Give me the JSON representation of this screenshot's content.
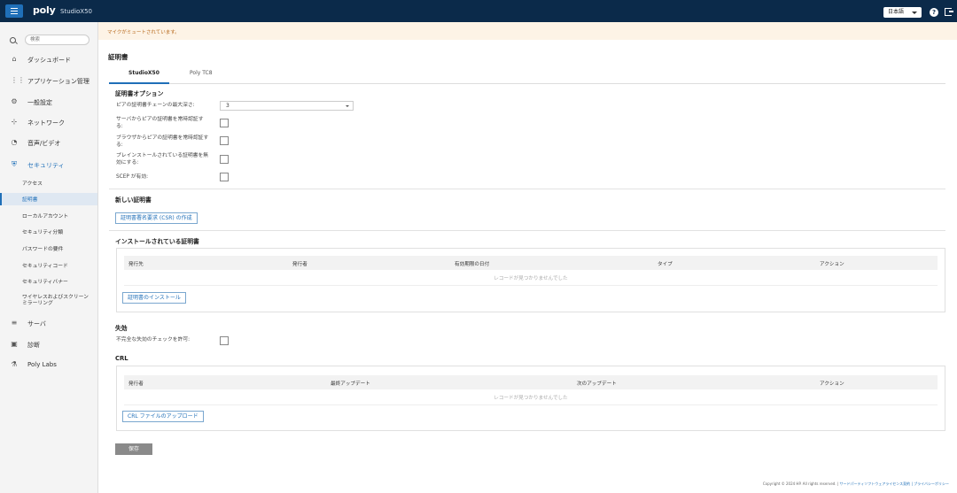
{
  "header": {
    "brand": "poly",
    "model": "StudioX50",
    "language": "日本語",
    "help_label": "?"
  },
  "sidebar": {
    "search_placeholder": "検索",
    "items": [
      {
        "label": "ダッシュボード",
        "icon": "home-icon"
      },
      {
        "label": "アプリケーション管理",
        "icon": "grid-icon"
      },
      {
        "label": "一般設定",
        "icon": "gear-icon"
      },
      {
        "label": "ネットワーク",
        "icon": "network-icon"
      },
      {
        "label": "音声/ビデオ",
        "icon": "video-icon"
      },
      {
        "label": "セキュリティ",
        "icon": "shield-icon"
      },
      {
        "label": "サーバ",
        "icon": "server-icon"
      },
      {
        "label": "診断",
        "icon": "diagnostics-icon"
      },
      {
        "label": "Poly Labs",
        "icon": "flask-icon"
      }
    ],
    "security_sub": [
      "アクセス",
      "証明書",
      "ローカルアカウント",
      "セキュリティ分類",
      "パスワードの要件",
      "セキュリティコード",
      "セキュリティバナー",
      "ワイヤレスおよびスクリーン\nミラーリング"
    ]
  },
  "main": {
    "notice": "マイクがミュートされています。",
    "page_title": "証明書",
    "tabs": [
      "StudioX50",
      "Poly TC8"
    ],
    "cert_options": {
      "title": "証明書オプション",
      "chain_depth_label": "ピアの証明書チェーンの最大深さ:",
      "chain_depth_value": "3",
      "server_verify_label": "サーバからピアの証明書を常時認証する:",
      "browser_verify_label": "ブラウザからピアの証明書を常時認証する:",
      "preinstalled_label": "プレインストールされている証明書を無効にする:",
      "scep_label": "SCEP が有効:"
    },
    "new_cert": {
      "title": "新しい証明書",
      "csr_button": "証明書署名要求 (CSR) の作成"
    },
    "installed": {
      "title": "インストールされている証明書",
      "columns": [
        "発行先",
        "発行者",
        "有効期限の日付",
        "タイプ",
        "アクション"
      ],
      "empty": "レコードが見つかりませんでした",
      "install_button": "証明書のインストール"
    },
    "revocation": {
      "title": "失効",
      "incomplete_label": "不完全な失効のチェックを許可:"
    },
    "crl": {
      "title": "CRL",
      "columns": [
        "発行者",
        "最終アップデート",
        "次のアップデート",
        "アクション"
      ],
      "empty": "レコードが見つかりませんでした",
      "upload_button": "CRL ファイルのアップロード"
    },
    "save_button": "保存",
    "footer": {
      "copyright": "Copyright © 2024 HP. All rights reserved. | ",
      "links": "サードパーティソフトウェアライセンス契約 | プライバシーポリシー"
    }
  }
}
